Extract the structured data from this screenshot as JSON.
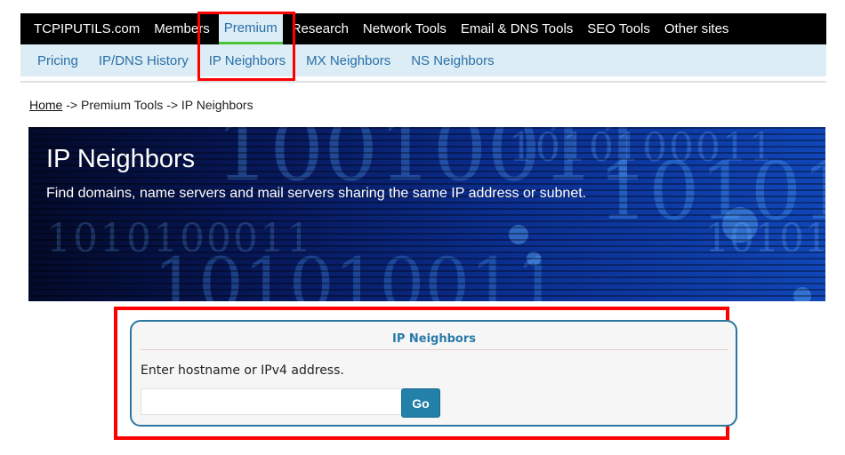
{
  "top_nav": {
    "items": [
      {
        "label": "TCPIPUTILS.com",
        "active": false
      },
      {
        "label": "Members",
        "active": false
      },
      {
        "label": "Premium",
        "active": true
      },
      {
        "label": "Research",
        "active": false
      },
      {
        "label": "Network Tools",
        "active": false
      },
      {
        "label": "Email & DNS Tools",
        "active": false
      },
      {
        "label": "SEO Tools",
        "active": false
      },
      {
        "label": "Other sites",
        "active": false
      }
    ]
  },
  "sub_nav": {
    "items": [
      {
        "label": "Pricing"
      },
      {
        "label": "IP/DNS History"
      },
      {
        "label": "IP Neighbors"
      },
      {
        "label": "MX Neighbors"
      },
      {
        "label": "NS Neighbors"
      }
    ]
  },
  "breadcrumb": {
    "home": "Home",
    "rest": " -> Premium Tools -> IP Neighbors"
  },
  "hero": {
    "title": "IP Neighbors",
    "subtitle": "Find domains, name servers and mail servers sharing the same IP address or subnet.",
    "bg_binary": [
      "10010011",
      "1010100011",
      "10101",
      "1010100011",
      "101010011",
      "10101"
    ]
  },
  "form": {
    "title": "IP Neighbors",
    "label": "Enter hostname or IPv4 address.",
    "input_value": "",
    "input_placeholder": "",
    "button_label": "Go"
  },
  "colors": {
    "nav_bg": "#000000",
    "subnav_bg": "#dcedf5",
    "link": "#2a6fa8",
    "active_underline": "#4cc43a",
    "panel_border": "#2b77a0",
    "button_bg": "#2380a8",
    "highlight": "#ff0000"
  }
}
